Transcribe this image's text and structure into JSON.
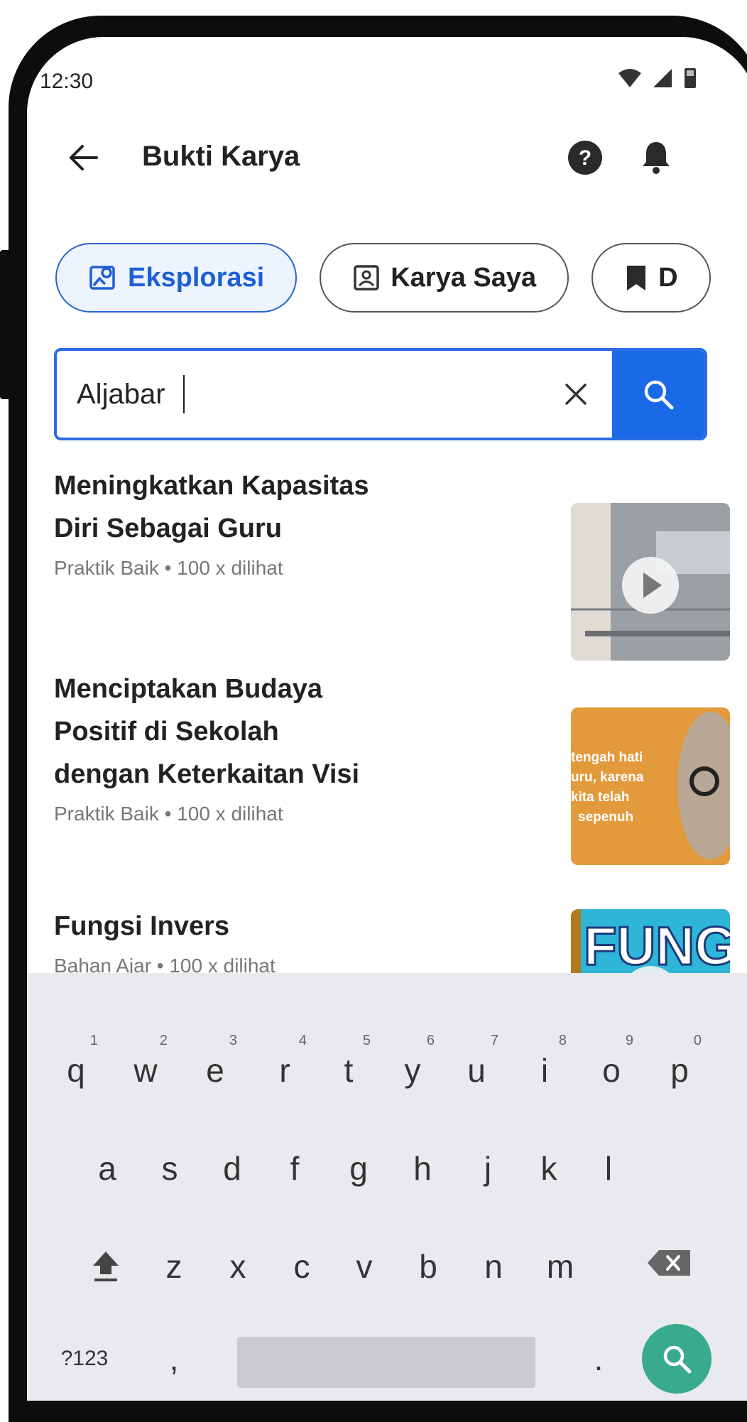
{
  "status_bar": {
    "time": "12:30"
  },
  "app_bar": {
    "title": "Bukti Karya"
  },
  "tabs": [
    {
      "label": "Eksplorasi",
      "active": true
    },
    {
      "label": "Karya Saya",
      "active": false
    },
    {
      "label": "D",
      "active": false
    }
  ],
  "search": {
    "value": "Aljabar"
  },
  "results": [
    {
      "title_line1": "Meningkatkan Kapasitas",
      "title_line2": "Diri Sebagai Guru",
      "title_line3": "",
      "meta": "Praktik Baik • 100 x dilihat",
      "thumb_type": "video"
    },
    {
      "title_line1": "Menciptakan Budaya",
      "title_line2": "Positif di Sekolah",
      "title_line3": "dengan Keterkaitan Visi",
      "meta": "Praktik Baik • 100 x dilihat",
      "thumb_type": "image",
      "thumb_text": [
        "tengah hati",
        "uru, karena",
        "kita telah",
        "sepenuh"
      ]
    },
    {
      "title_line1": "Fungsi Invers",
      "title_line2": "",
      "title_line3": "",
      "meta": "Bahan Ajar • 100 x dilihat",
      "thumb_type": "video",
      "thumb_text": [
        "FUNG"
      ]
    }
  ],
  "keyboard": {
    "row1": [
      "q",
      "w",
      "e",
      "r",
      "t",
      "y",
      "u",
      "i",
      "o",
      "p"
    ],
    "row1_hints": [
      "1",
      "2",
      "3",
      "4",
      "5",
      "6",
      "7",
      "8",
      "9",
      "0"
    ],
    "row2": [
      "a",
      "s",
      "d",
      "f",
      "g",
      "h",
      "j",
      "k",
      "l"
    ],
    "row3": [
      "z",
      "x",
      "c",
      "v",
      "b",
      "n",
      "m"
    ],
    "symbols_label": "?123",
    "comma": ",",
    "period": "."
  },
  "colors": {
    "accent": "#1a6ae8",
    "action_key": "#3aaa8f",
    "keyboard_bg": "#e8eaed"
  }
}
